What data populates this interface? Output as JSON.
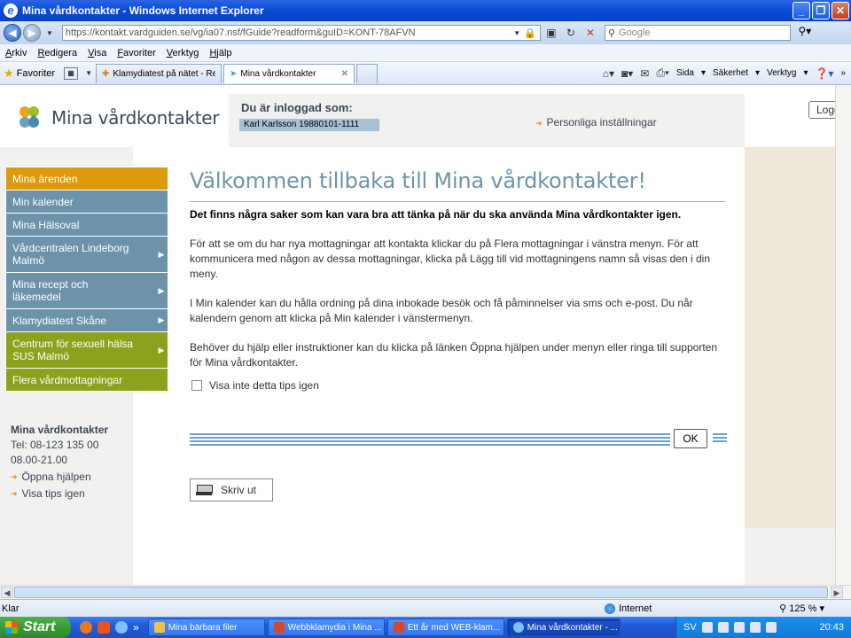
{
  "window": {
    "title": "Mina vårdkontakter - Windows Internet Explorer"
  },
  "address_bar": {
    "url": "https://kontakt.vardguiden.se/vg/ia07.nsf/fGuide?readform&guID=KONT-78AFVN",
    "search_placeholder": "Google"
  },
  "menu": [
    "Arkiv",
    "Redigera",
    "Visa",
    "Favoriter",
    "Verktyg",
    "Hjälp"
  ],
  "favorites_label": "Favoriter",
  "tabs": [
    {
      "label": "Klamydiatest på nätet - Regi...",
      "active": false
    },
    {
      "label": "Mina vårdkontakter",
      "active": true
    }
  ],
  "command_bar": {
    "page": "Sida",
    "safety": "Säkerhet",
    "tools": "Verktyg"
  },
  "header": {
    "logo_text": "Mina vårdkontakter",
    "logged_in_label": "Du är inloggad som:",
    "user": "Karl Karlsson 19880101-1111",
    "settings_link": "Personliga inställningar",
    "logout": "Logga"
  },
  "nav": [
    {
      "label": "Mina ärenden",
      "color": "orange",
      "chevron": false
    },
    {
      "label": "Min kalender",
      "color": "blue",
      "chevron": false
    },
    {
      "label": "Mina Hälsoval",
      "color": "blue",
      "chevron": false
    },
    {
      "label": "Vårdcentralen Lindeborg Malmö",
      "color": "blue",
      "chevron": true
    },
    {
      "label": "Mina recept och läkemedel",
      "color": "blue",
      "chevron": true
    },
    {
      "label": "Klamydiatest Skåne",
      "color": "blue",
      "chevron": true
    },
    {
      "label": "Centrum för sexuell hälsa SUS Malmö",
      "color": "green",
      "chevron": true
    },
    {
      "label": "Flera vårdmottagningar",
      "color": "green",
      "chevron": false
    }
  ],
  "contact": {
    "title": "Mina vårdkontakter",
    "phone": "Tel: 08-123 135 00",
    "hours": "08.00-21.00",
    "links": [
      "Öppna hjälpen",
      "Visa tips igen"
    ]
  },
  "main": {
    "heading": "Välkommen tillbaka till Mina vårdkontakter!",
    "lead": "Det finns några saker som kan vara bra att tänka på när du ska använda Mina vårdkontakter igen.",
    "paragraphs": [
      "För att se om du har nya mottagningar att kontakta klickar du på Flera mottagningar i vänstra menyn. För att kommunicera med någon av dessa mottagningar, klicka på Lägg till vid mottagningens namn så visas den i din meny.",
      "I Min kalender kan du hålla ordning på dina inbokade besök och få påminnelser via sms och e-post. Du når kalendern genom att klicka på Min kalender i vänstermenyn.",
      "Behöver du hjälp eller instruktioner kan du klicka på länken Öppna hjälpen under menyn eller ringa till supporten för Mina vårdkontakter."
    ],
    "checkbox_label": "Visa inte detta tips igen",
    "ok_label": "OK",
    "print_label": "Skriv ut"
  },
  "status_bar": {
    "status": "Klar",
    "zone": "Internet",
    "zoom": "125 %"
  },
  "taskbar": {
    "start": "Start",
    "tasks": [
      {
        "label": "Mina bärbara filer",
        "icon": "folder",
        "active": false
      },
      {
        "label": "Webbklamydia i Mina ...",
        "icon": "word",
        "active": false
      },
      {
        "label": "Ett år med WEB-klam...",
        "icon": "word",
        "active": false
      },
      {
        "label": "Mina vårdkontakter - ...",
        "icon": "ie",
        "active": true
      }
    ],
    "language": "SV",
    "clock": "20:43"
  },
  "colors": {
    "nav_orange": "#dc9a0c",
    "nav_blue": "#6c93aa",
    "nav_green": "#8ba31c",
    "heading_blue": "#6d94ab",
    "link_arrow": "#f08a1a"
  }
}
